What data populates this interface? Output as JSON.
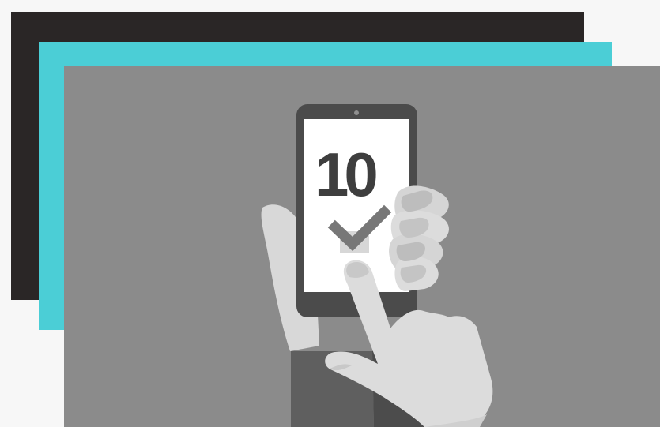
{
  "image": {
    "description_layers": [
      "dark-card",
      "teal-card",
      "gray-illustration-card"
    ],
    "colors": {
      "background": "#f7f7f7",
      "dark_card": "#2a2626",
      "teal_card": "#4bced6",
      "gray_card": "#8b8b8b",
      "phone_body": "#4b4b4b",
      "screen": "#ffffff",
      "hand": "#dcdcdc",
      "sleeve": "#5f5f5f"
    },
    "phone": {
      "screen_number": "10",
      "icon": "checkbox-check-icon"
    }
  }
}
